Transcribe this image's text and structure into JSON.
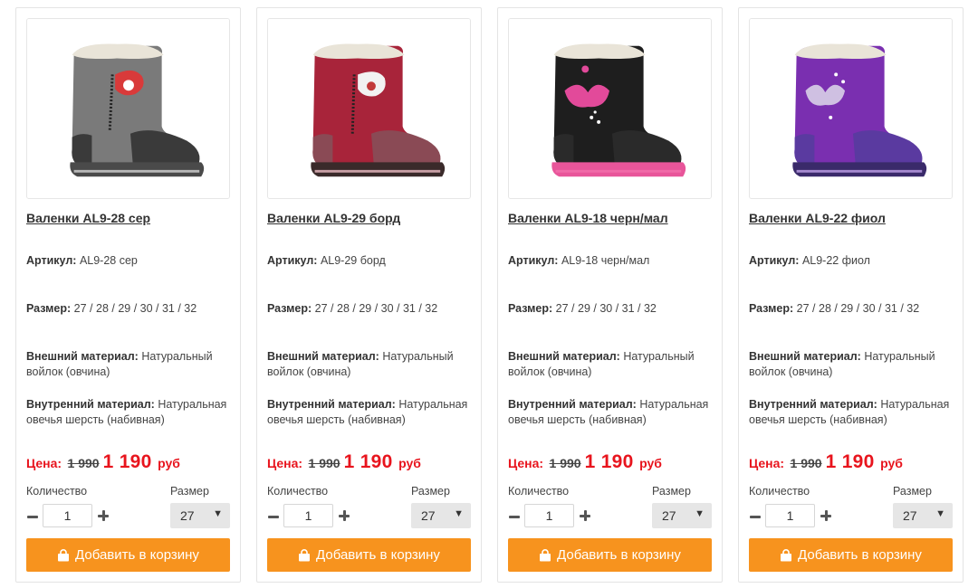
{
  "products": [
    {
      "title": "Валенки AL9-28 сер",
      "article_label": "Артикул:",
      "article": "AL9-28 сер",
      "size_label": "Размер:",
      "sizes": "27 / 28 / 29 / 30 / 31 / 32",
      "outer_label": "Внешний материал:",
      "outer": "Натуральный войлок (овчина)",
      "inner_label": "Внутренний материал:",
      "inner": "Натуральная овечья шерсть (набивная)",
      "price_label": "Цена:",
      "old_price": "1 990",
      "new_price": "1 190",
      "currency": "руб",
      "qty_label": "Количество",
      "qty": "1",
      "size_select_label": "Размер",
      "size_selected": "27",
      "cart_label": "Добавить в корзину",
      "image_icon": "gray-felt-boot",
      "colors": {
        "body": "#7a7a7a",
        "dark": "#3a3a3a",
        "sole": "#4a4a4a",
        "trim": "#b8b8b8",
        "accent": "#d93a3a"
      }
    },
    {
      "title": "Валенки AL9-29 борд",
      "article_label": "Артикул:",
      "article": "AL9-29 борд",
      "size_label": "Размер:",
      "sizes": "27 / 28 / 29 / 30 / 31 / 32",
      "outer_label": "Внешний материал:",
      "outer": "Натуральный войлок (овчина)",
      "inner_label": "Внутренний материал:",
      "inner": "Натуральная овечья шерсть (набивная)",
      "price_label": "Цена:",
      "old_price": "1 990",
      "new_price": "1 190",
      "currency": "руб",
      "qty_label": "Количество",
      "qty": "1",
      "size_select_label": "Размер",
      "size_selected": "27",
      "cart_label": "Добавить в корзину",
      "image_icon": "burgundy-felt-boot",
      "colors": {
        "body": "#a8243a",
        "dark": "#8a4a55",
        "sole": "#3a2a2a",
        "trim": "#c9a0a6",
        "accent": "#f2f2f2"
      }
    },
    {
      "title": "Валенки AL9-18 черн/мал",
      "article_label": "Артикул:",
      "article": "AL9-18 черн/мал",
      "size_label": "Размер:",
      "sizes": "27 / 29 / 30 / 31 / 32",
      "outer_label": "Внешний материал:",
      "outer": "Натуральный войлок (овчина)",
      "inner_label": "Внутренний материал:",
      "inner": "Натуральная овечья шерсть (набивная)",
      "price_label": "Цена:",
      "old_price": "1 990",
      "new_price": "1 190",
      "currency": "руб",
      "qty_label": "Количество",
      "qty": "1",
      "size_select_label": "Размер",
      "size_selected": "27",
      "cart_label": "Добавить в корзину",
      "image_icon": "black-pink-felt-boot",
      "colors": {
        "body": "#1e1e1e",
        "dark": "#2a2a2a",
        "sole": "#e8559a",
        "trim": "#f06aa8",
        "accent": "#e24a9a"
      }
    },
    {
      "title": "Валенки AL9-22 фиол",
      "article_label": "Артикул:",
      "article": "AL9-22 фиол",
      "size_label": "Размер:",
      "sizes": "27 / 28 / 29 / 30 / 31 / 32",
      "outer_label": "Внешний материал:",
      "outer": "Натуральный войлок (овчина)",
      "inner_label": "Внутренний материал:",
      "inner": "Натуральная овечья шерсть (набивная)",
      "price_label": "Цена:",
      "old_price": "1 990",
      "new_price": "1 190",
      "currency": "руб",
      "qty_label": "Количество",
      "qty": "1",
      "size_select_label": "Размер",
      "size_selected": "27",
      "cart_label": "Добавить в корзину",
      "image_icon": "purple-felt-boot",
      "colors": {
        "body": "#7a2fb0",
        "dark": "#5a3aa0",
        "sole": "#3a2a6a",
        "trim": "#a68ad0",
        "accent": "#d8d0e8"
      }
    }
  ],
  "colors": {
    "price_red": "#e8141d",
    "button_orange": "#f7931e",
    "select_bg": "#e6e6e6"
  }
}
